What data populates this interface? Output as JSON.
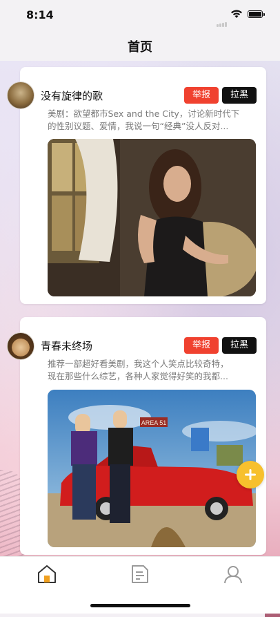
{
  "status_bar": {
    "time": "8:14"
  },
  "nav": {
    "title": "首页"
  },
  "posts": [
    {
      "username": "没有旋律的歌",
      "excerpt_line1": "美剧：欲望都市Sex and the City，讨论新时代下",
      "excerpt_line2": "的性别议题、爱情，我说一句“经典”没人反对...",
      "report_label": "举报",
      "block_label": "拉黑"
    },
    {
      "username": "青春未终场",
      "excerpt_line1": "推荐一部超好看美剧，我这个人笑点比较奇特，",
      "excerpt_line2": "现在那些什么综艺，各种人家觉得好笑的我都...",
      "report_label": "举报",
      "block_label": "拉黑",
      "photo_sign_text": "AREA 51"
    }
  ],
  "tabs": [
    {
      "icon": "home-icon",
      "active": true
    },
    {
      "icon": "document-icon",
      "active": false
    },
    {
      "icon": "profile-icon",
      "active": false
    }
  ],
  "colors": {
    "report": "#f0412f",
    "block": "#111111",
    "fab": "#f7c02d",
    "tab_active": "#f0a020"
  }
}
